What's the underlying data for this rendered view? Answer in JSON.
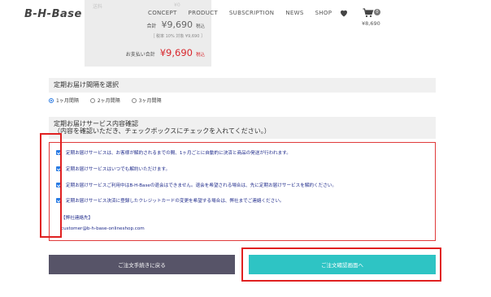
{
  "header": {
    "logo": "B-H-Base",
    "nav": [
      "CONCEPT",
      "PRODUCT",
      "SUBSCRIPTION",
      "NEWS",
      "SHOP"
    ],
    "icons": [
      "heart-icon",
      "cart-icon"
    ],
    "cart_count": "0",
    "cart_total": "¥8,690"
  },
  "summary": {
    "faded_left": "送料",
    "faded_right": "¥0",
    "total_label": "合計",
    "total_amount": "¥9,690",
    "tax_label": "税込",
    "breakdown": "［ 税率 10% 対象  ¥9,690 ］",
    "pay_label": "お支払い合計",
    "pay_amount": "¥9,690",
    "pay_tax_label": "税込",
    "accent_color": "#d8262c"
  },
  "interval": {
    "title": "定期お届け間隔を選択",
    "options": [
      "1ヶ月間隔",
      "2ヶ月間隔",
      "3ヶ月間隔"
    ],
    "selected": "1ヶ月間隔"
  },
  "confirm": {
    "title": "定期お届けサービス内容確認",
    "subtitle": "（内容を確認いただき、チェックボックスにチェックを入れてください。）",
    "items": [
      "定期お届けサービスは、お客様が解約されるまでの間、1ヶ月ごとに自動的に決済と商品の発送が行われます。",
      "定期お届けサービスはいつでも解約いただけます。",
      "定期お届けサービスご利用中はB-H-Baseの退会はできません。退会を希望される場合は、先に定期お届けサービスを解約ください。",
      "定期お届けサービス決済に登録したクレジットカードの変更を希望する場合は、弊社までご連絡ください。"
    ],
    "contact_title": "【弊社連絡先】",
    "contact_email": "customer@b-h-base-onlineshop.com"
  },
  "buttons": {
    "back": "ご注文手続きに戻る",
    "confirm": "ご注文確認画面へ"
  }
}
